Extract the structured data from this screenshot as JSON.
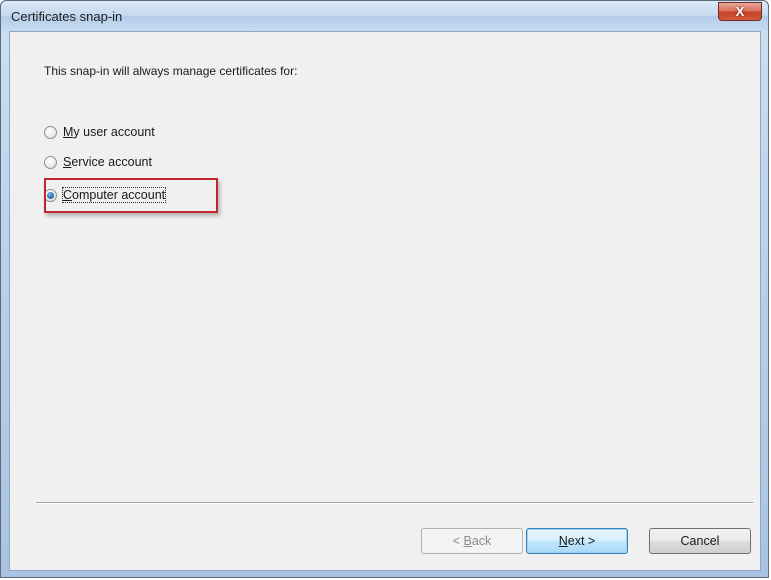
{
  "window": {
    "title": "Certificates snap-in",
    "close_glyph": "X"
  },
  "prompt": "This snap-in will always manage certificates for:",
  "options": [
    {
      "accel": "M",
      "rest": "y user account",
      "selected": false
    },
    {
      "accel": "S",
      "rest": "ervice account",
      "selected": false
    },
    {
      "accel": "C",
      "rest": "omputer account",
      "selected": true
    }
  ],
  "buttons": {
    "back": {
      "prefix": "< ",
      "accel": "B",
      "rest": "ack",
      "enabled": false
    },
    "next": {
      "accel": "N",
      "rest": "ext >",
      "enabled": true
    },
    "cancel": {
      "label": "Cancel",
      "enabled": true
    }
  },
  "colors": {
    "highlight_border": "#c0262d",
    "close_button": "#c4432a",
    "default_button_border": "#3c7fb1"
  }
}
